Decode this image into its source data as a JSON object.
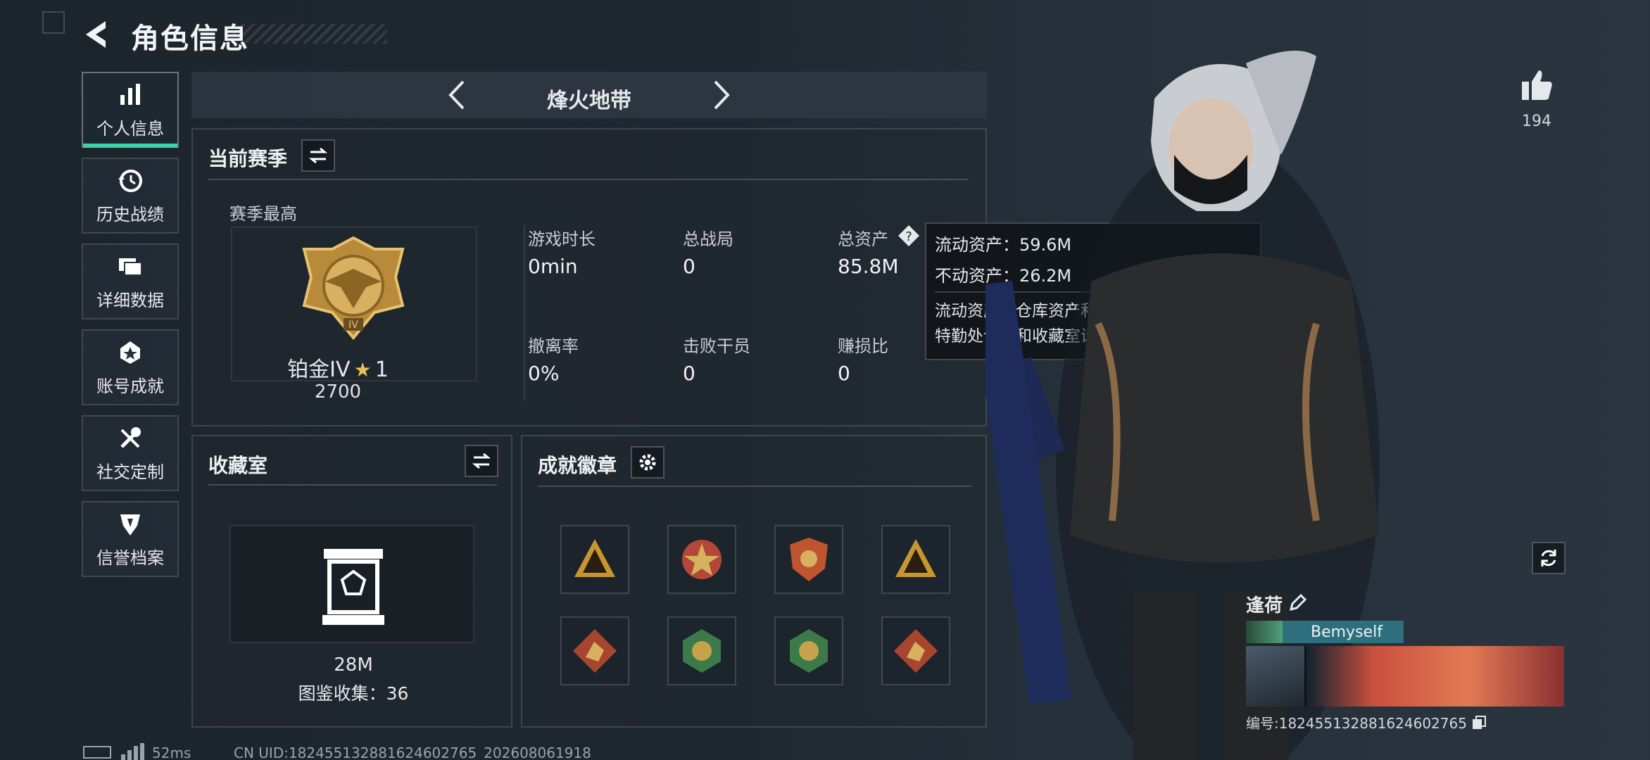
{
  "header": {
    "title": "角色信息"
  },
  "nav": [
    {
      "label": "个人信息",
      "icon": "bar-chart-icon",
      "active": true
    },
    {
      "label": "历史战绩",
      "icon": "history-clock-icon",
      "active": false
    },
    {
      "label": "详细数据",
      "icon": "folders-icon",
      "active": false
    },
    {
      "label": "账号成就",
      "icon": "achievement-star-icon",
      "active": false
    },
    {
      "label": "社交定制",
      "icon": "tools-icon",
      "active": false
    },
    {
      "label": "信誉档案",
      "icon": "shield-icon",
      "active": false
    }
  ],
  "mode": {
    "name": "烽火地带"
  },
  "season": {
    "header": "当前赛季",
    "best_label": "赛季最高",
    "rank_name": "铂金IV",
    "rank_stars": "1",
    "rank_score": "2700",
    "stats": [
      {
        "label": "游戏时长",
        "value": "0min"
      },
      {
        "label": "总战局",
        "value": "0"
      },
      {
        "label": "总资产",
        "value": "85.8M"
      },
      {
        "label": "撤离率",
        "value": "0%"
      },
      {
        "label": "击败干员",
        "value": "0"
      },
      {
        "label": "赚损比",
        "value": "0"
      }
    ]
  },
  "tooltip": {
    "line1": "流动资产：59.6M",
    "line2": "不动资产：26.2M",
    "desc": "流动资产为仓库资产和哈夫币，不动资产为特勤处设施和收藏室设施"
  },
  "collection": {
    "header": "收藏室",
    "value": "28M",
    "count_text": "图鉴收集：36"
  },
  "achievements": {
    "header": "成就徽章",
    "badges": [
      {
        "icon": "triangle-badge-icon",
        "color": "#c8962e"
      },
      {
        "icon": "star-medal-icon",
        "color": "#b5473a"
      },
      {
        "icon": "crest-badge-icon",
        "color": "#c0542e"
      },
      {
        "icon": "triangle-bars-badge-icon",
        "color": "#c8962e"
      },
      {
        "icon": "dragon-badge-icon",
        "color": "#a8452e"
      },
      {
        "icon": "wasp-badge-icon",
        "color": "#3c7a4a"
      },
      {
        "icon": "runner-badge-icon",
        "color": "#3c7a4a"
      },
      {
        "icon": "soldier-badge-icon",
        "color": "#a8452e"
      }
    ]
  },
  "profile": {
    "likes": "194",
    "name": "逢荷",
    "tag": "Bemyself",
    "id_text": "编号:182455132881624602765"
  },
  "footer": {
    "ping": "52ms",
    "uid": "CN UID:182455132881624602765_202608061918"
  },
  "colors": {
    "accent": "#3fd3a5",
    "gold": "#c9a24a",
    "tag_bg": "#2e6f7e"
  }
}
